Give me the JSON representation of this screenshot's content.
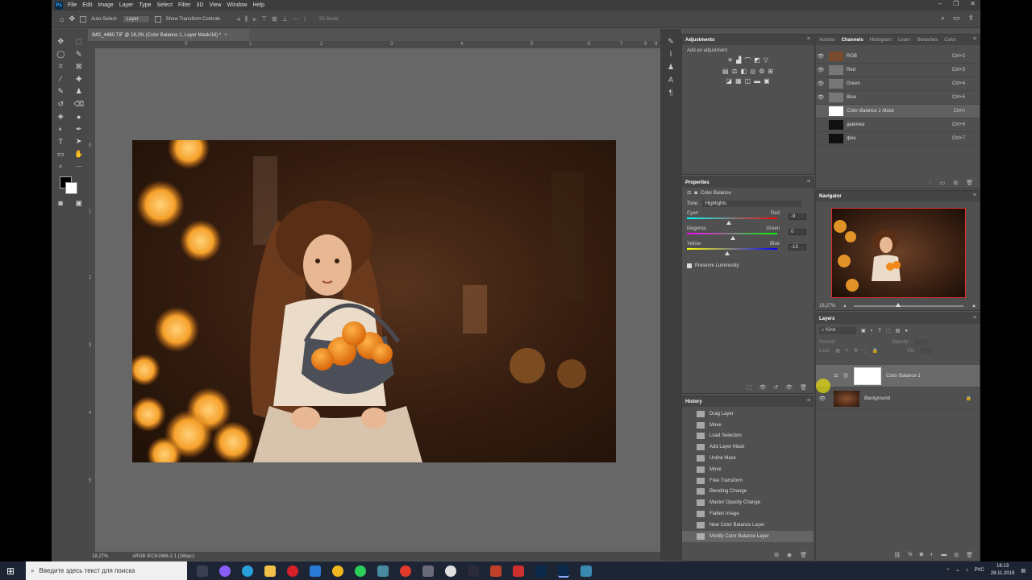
{
  "app": {
    "logo": "Ps",
    "menu": [
      "File",
      "Edit",
      "Image",
      "Layer",
      "Type",
      "Select",
      "Filter",
      "3D",
      "View",
      "Window",
      "Help"
    ]
  },
  "options": {
    "auto_select_label": "Auto-Select:",
    "auto_select_value": "Layer",
    "show_transform_label": "Show Transform Controls",
    "mode_3d": "3D Mode:"
  },
  "document": {
    "tab_title": "IMG_4480.TIF @ 18,3% (Color Balance 1, Layer Mask/16) *",
    "zoom": "18,27%",
    "profile": "sRGB IEC61966-2.1 (16bpc)"
  },
  "ruler": {
    "top_numbers": [
      "0",
      "1",
      "2",
      "3",
      "4",
      "5",
      "6",
      "7",
      "8",
      "9"
    ],
    "left_numbers": [
      "0",
      "1",
      "2",
      "3",
      "4",
      "5"
    ]
  },
  "adjustments": {
    "title": "Adjustments",
    "add_label": "Add an adjustment"
  },
  "channels": {
    "tabs": [
      "Actions",
      "Channels",
      "Histogram",
      "Learn",
      "Swatches",
      "Color"
    ],
    "rows": [
      {
        "name": "RGB",
        "shortcut": "Ctrl+2"
      },
      {
        "name": "Red",
        "shortcut": "Ctrl+3"
      },
      {
        "name": "Green",
        "shortcut": "Ctrl+4"
      },
      {
        "name": "Blue",
        "shortcut": "Ctrl+5"
      },
      {
        "name": "Color Balance 1 Mask",
        "shortcut": "Ctrl+\\"
      },
      {
        "name": "девочка",
        "shortcut": "Ctrl+6"
      },
      {
        "name": "фон",
        "shortcut": "Ctrl+7"
      }
    ]
  },
  "properties": {
    "title": "Properties",
    "type": "Color Balance",
    "tone_label": "Tone:",
    "tone_value": "Highlights",
    "sliders": [
      {
        "left": "Cyan",
        "right": "Red",
        "value": "-9",
        "level": -9
      },
      {
        "left": "Magenta",
        "right": "Green",
        "value": "0",
        "level": 0
      },
      {
        "left": "Yellow",
        "right": "Blue",
        "value": "-13",
        "level": -13
      }
    ],
    "preserve": "Preserve Luminosity"
  },
  "navigator": {
    "title": "Navigator",
    "zoom": "18,27%"
  },
  "history": {
    "title": "History",
    "items": [
      "Drag Layer",
      "Move",
      "Load Selection",
      "Add Layer Mask",
      "Unlink Mask",
      "Move",
      "Free Transform",
      "Blending Change",
      "Master Opacity Change",
      "Flatten Image",
      "New Color Balance Layer",
      "Modify Color Balance Layer"
    ]
  },
  "layers": {
    "title": "Layers",
    "kind": "Kind",
    "blend": "Normal",
    "opacity_label": "Opacity:",
    "lock_label": "Lock:",
    "fill_label": "Fill:",
    "items": [
      {
        "name": "Color Balance 1"
      },
      {
        "name": "Background"
      }
    ]
  },
  "taskbar": {
    "search_placeholder": "Введите здесь текст для поиска",
    "lang": "РУС",
    "time": "16:13",
    "date": "28.11.2019"
  }
}
